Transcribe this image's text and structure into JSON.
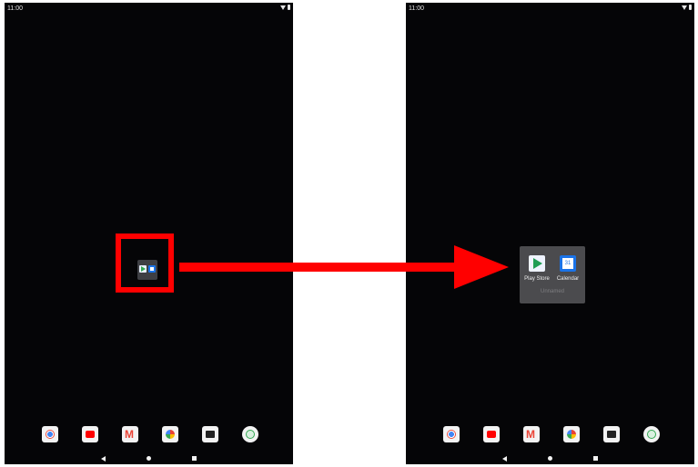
{
  "screens": {
    "before": {
      "status_time": "11:00",
      "status_icons": [
        "wifi-icon",
        "battery-icon"
      ],
      "folder": {
        "apps": [
          "Play Store",
          "Calendar"
        ]
      },
      "dock": [
        "chrome-icon",
        "youtube-icon",
        "gmail-icon",
        "photos-icon",
        "camera-icon",
        "settings-icon"
      ]
    },
    "after": {
      "status_time": "11:00",
      "status_icons": [
        "wifi-icon",
        "battery-icon"
      ],
      "folder_open": {
        "apps": [
          {
            "label": "Play Store",
            "icon": "play-store-icon"
          },
          {
            "label": "Calendar",
            "icon": "calendar-icon"
          }
        ],
        "name_text": "Unnamed"
      },
      "dock": [
        "chrome-icon",
        "youtube-icon",
        "gmail-icon",
        "photos-icon",
        "camera-icon",
        "settings-icon"
      ]
    }
  },
  "annotation": {
    "highlight_color": "#ff0000",
    "arrow": "open-folder"
  }
}
